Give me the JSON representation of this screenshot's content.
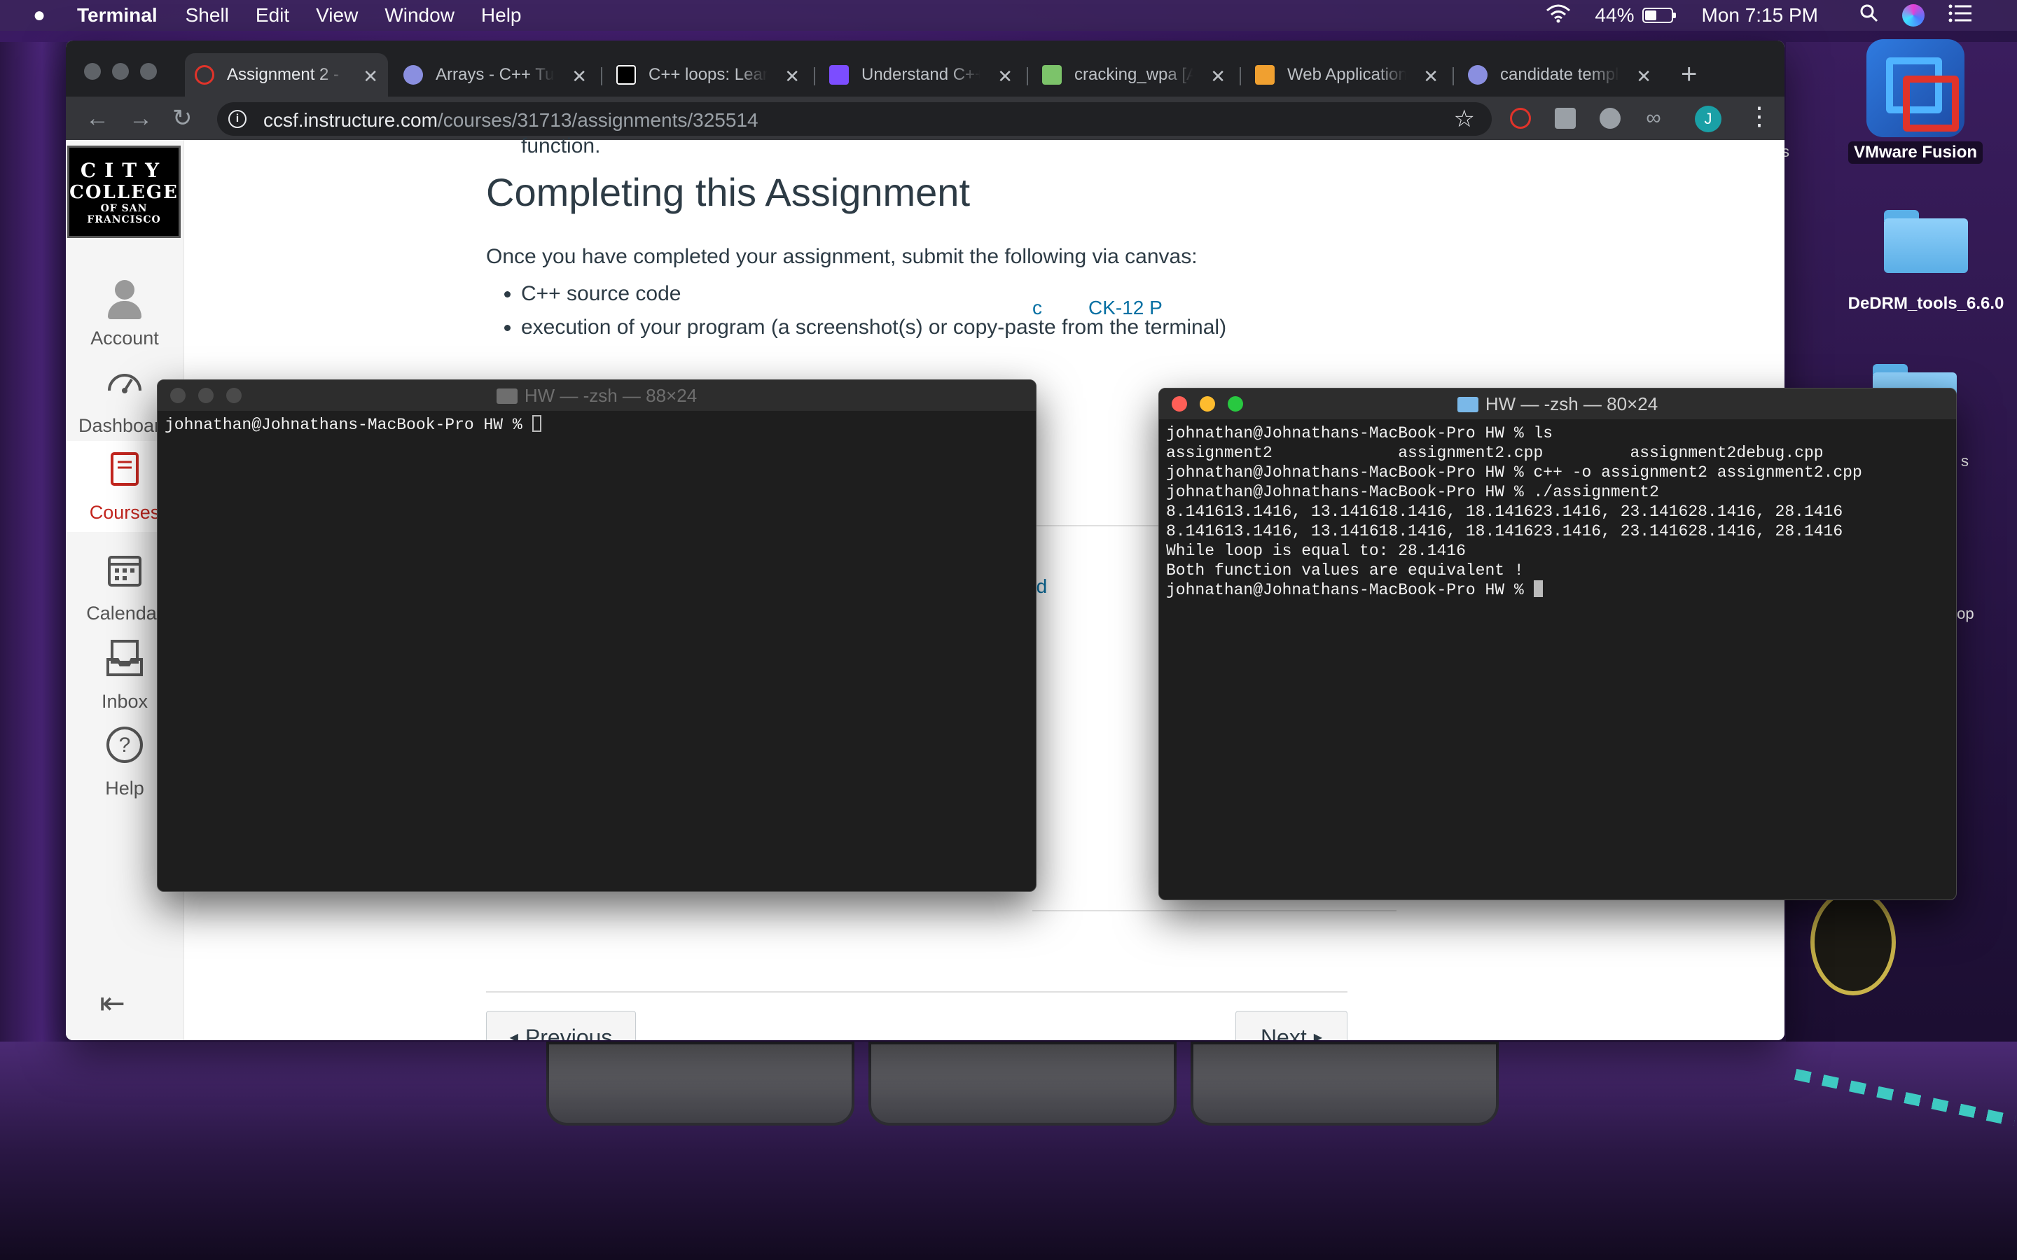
{
  "menubar": {
    "app": "Terminal",
    "menus": [
      "Shell",
      "Edit",
      "View",
      "Window",
      "Help"
    ],
    "battery": "44%",
    "clock": "Mon 7:15 PM"
  },
  "desktop": {
    "vmware_label": "VMware Fusion",
    "folder_label": "DeDRM_tools_6.6.0",
    "peek_s1": "s",
    "peek_s2": "s",
    "peek_top": "top"
  },
  "browser": {
    "tabs": [
      {
        "title": "Assignment 2 - ",
        "active": true,
        "favicon_color": "#e0332a"
      },
      {
        "title": "Arrays - C++ Tut",
        "favicon_color": "#8a8fe0"
      },
      {
        "title": "C++ loops: Learn",
        "favicon_color": "#ffffff"
      },
      {
        "title": "Understand C++",
        "favicon_color": "#7c4dff"
      },
      {
        "title": "cracking_wpa [A",
        "favicon_color": "#7cc36a"
      },
      {
        "title": "Web Application",
        "favicon_color": "#f0a030"
      },
      {
        "title": "candidate templ",
        "favicon_color": "#8a8fe0"
      }
    ],
    "url_host": "ccsf.instructure.com",
    "url_path": "/courses/31713/assignments/325514",
    "profile_initial": "J"
  },
  "canvas": {
    "logo": {
      "line1": "CITY",
      "line2": "COLLEGE",
      "line3": "OF SAN FRANCISCO"
    },
    "nav": [
      "Account",
      "Dashboard",
      "Courses",
      "Calendar",
      "Inbox",
      "Help"
    ],
    "fragment": "function.",
    "heading": "Completing this Assignment",
    "paragraph": "Once you have completed your assignment, submit the following via canvas:",
    "bullets": [
      "C++ source code",
      "execution of your program (a screenshot(s) or copy-paste from the terminal)"
    ],
    "peek_link_1": "c",
    "peek_link_2": "CK-12 P",
    "peek_link_3": "ed",
    "prev": "Previous",
    "next": "Next"
  },
  "terminal_left": {
    "title": "HW — -zsh — 88×24",
    "lines": [
      "johnathan@Johnathans-MacBook-Pro HW % "
    ]
  },
  "terminal_right": {
    "title": "HW — -zsh — 80×24",
    "lines": [
      "johnathan@Johnathans-MacBook-Pro HW % ls",
      "assignment2             assignment2.cpp         assignment2debug.cpp",
      "johnathan@Johnathans-MacBook-Pro HW % c++ -o assignment2 assignment2.cpp",
      "johnathan@Johnathans-MacBook-Pro HW % ./assignment2",
      "8.141613.1416, 13.141618.1416, 18.141623.1416, 23.141628.1416, 28.1416",
      "8.141613.1416, 13.141618.1416, 18.141623.1416, 23.141628.1416, 28.1416",
      "While loop is equal to: 28.1416",
      "Both function values are equivalent !",
      "johnathan@Johnathans-MacBook-Pro HW % "
    ]
  },
  "colors": {
    "terminal_bg": "#1e1e1e",
    "canvas_active": "#c3261f",
    "link": "#0770a3"
  }
}
